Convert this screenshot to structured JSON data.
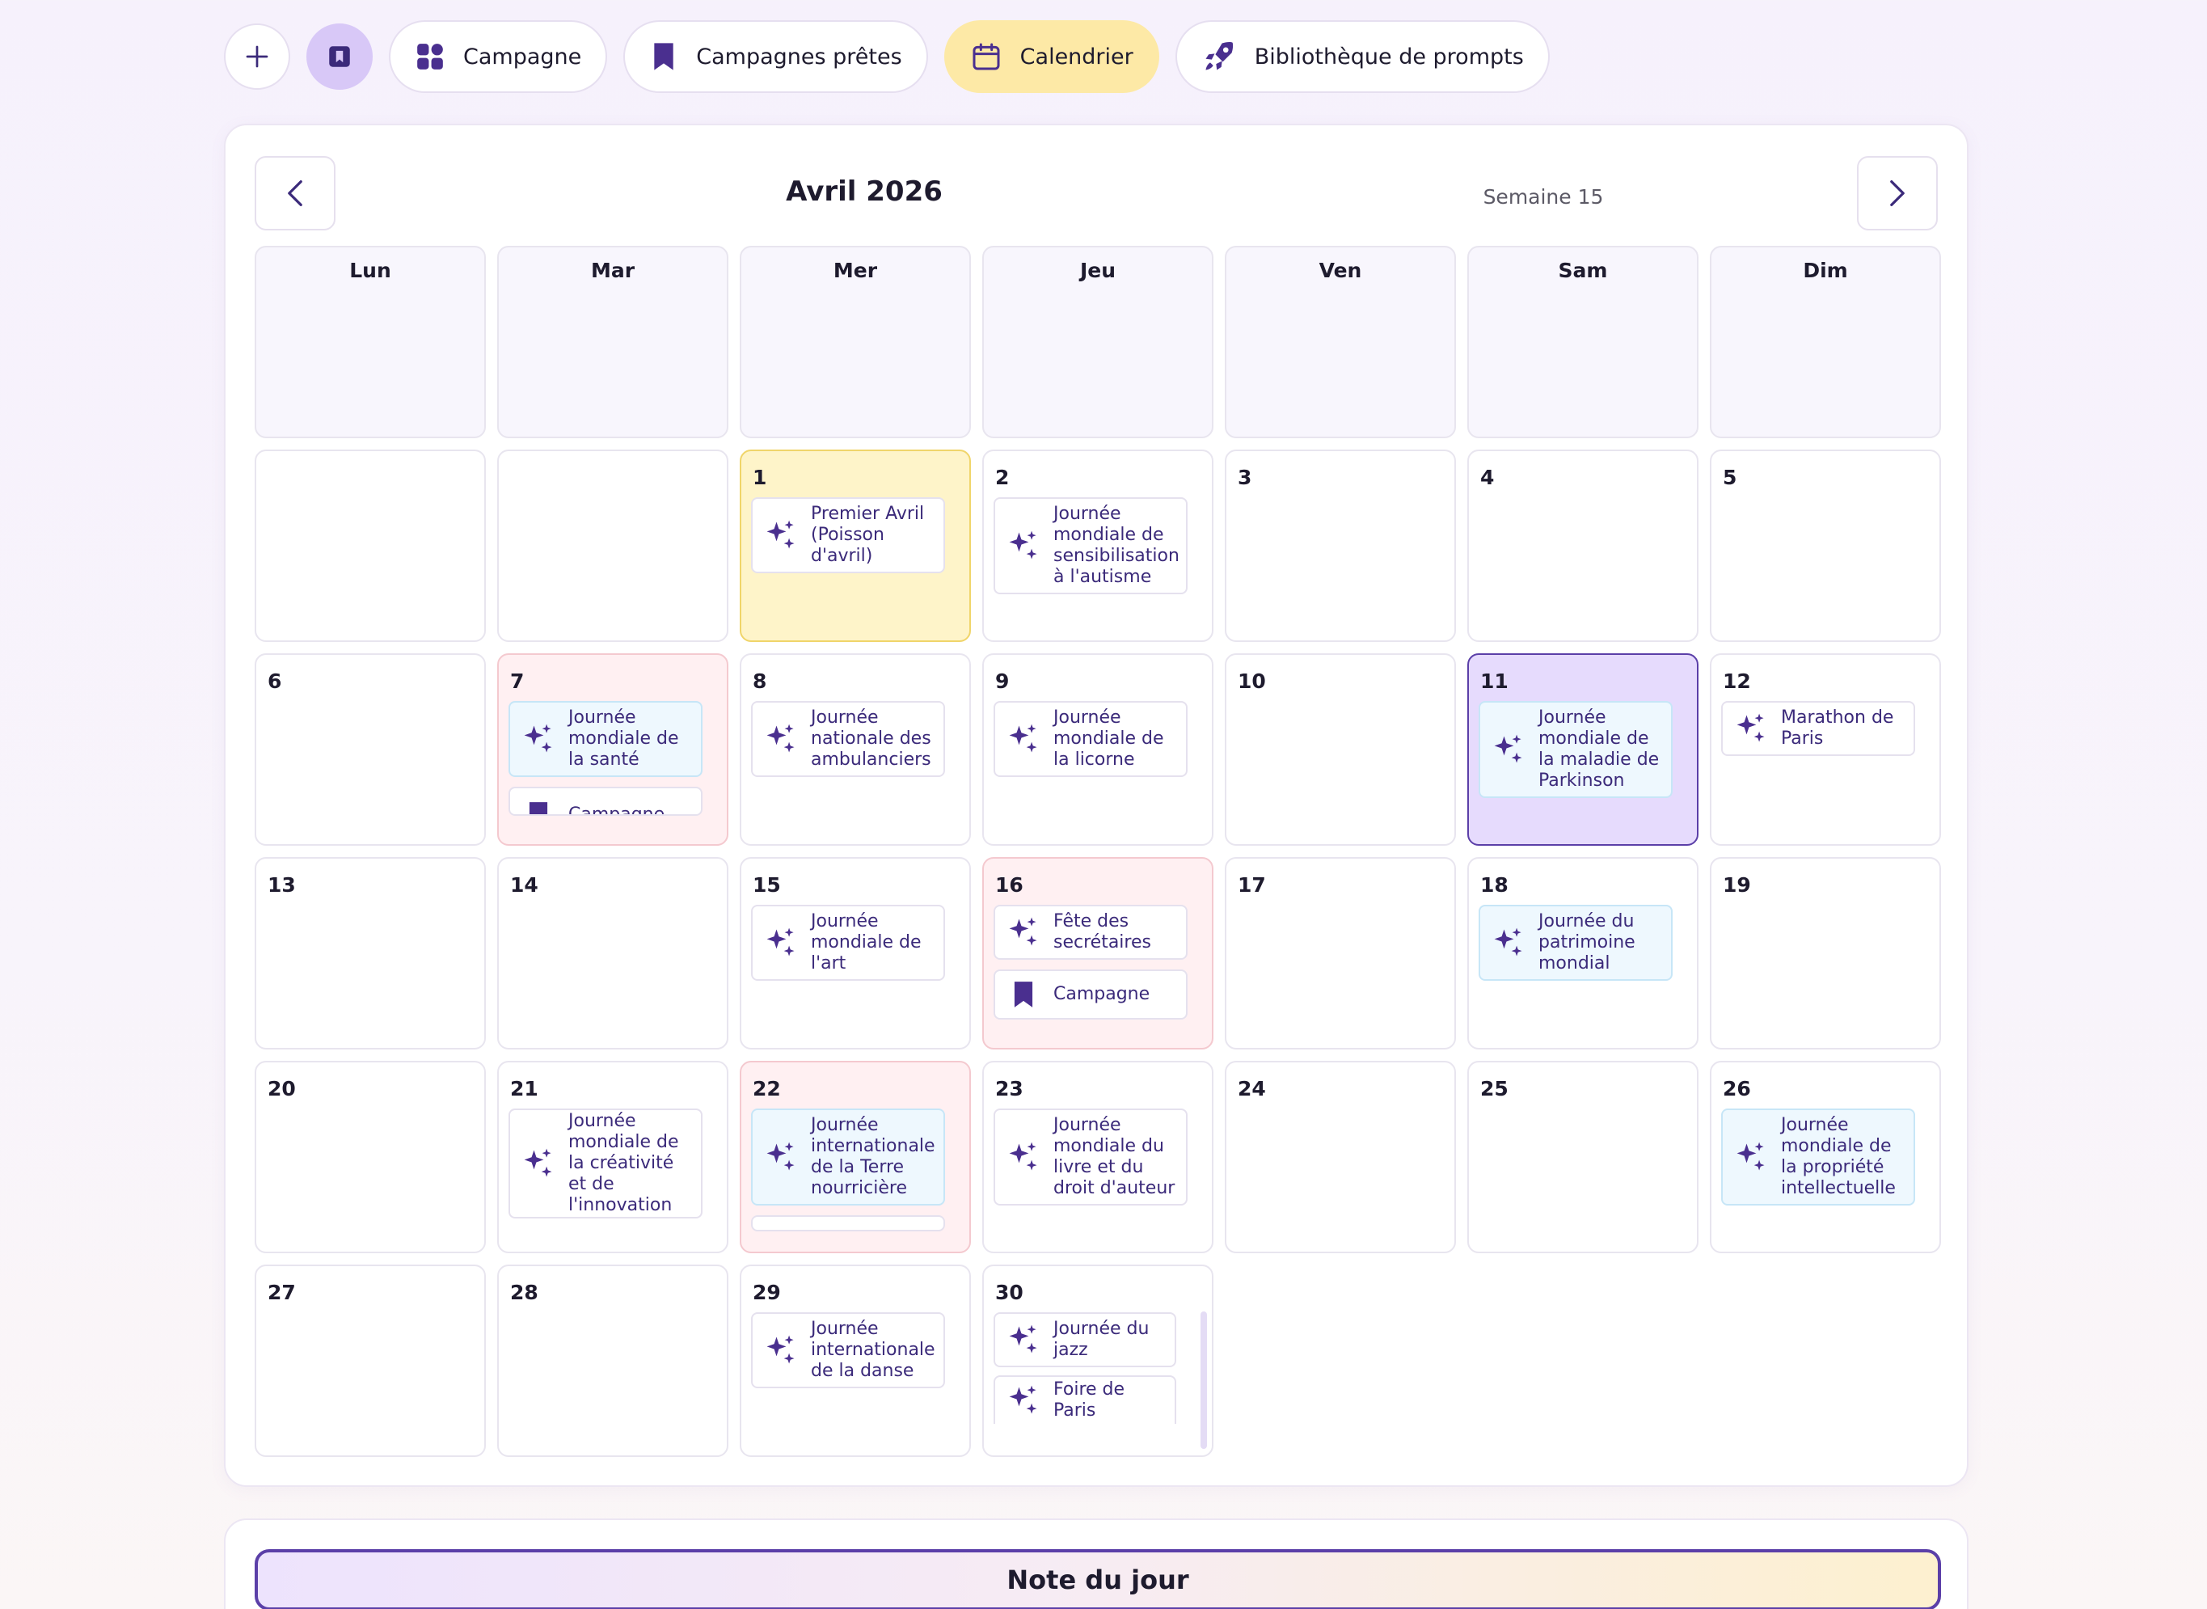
{
  "toolbar": {
    "campaign_label": "Campagne",
    "ready_campaigns_label": "Campagnes prêtes",
    "calendar_label": "Calendrier",
    "prompt_library_label": "Bibliothèque de prompts"
  },
  "calendar": {
    "month_title": "Avril 2026",
    "week_label": "Semaine 15",
    "weekdays": [
      "Lun",
      "Mar",
      "Mer",
      "Jeu",
      "Ven",
      "Sam",
      "Dim"
    ],
    "days": {
      "d1": {
        "num": "1",
        "events": [
          "Premier Avril (Poisson d'avril)"
        ]
      },
      "d2": {
        "num": "2",
        "events": [
          "Journée mondiale de sensibilisation à l'autisme"
        ]
      },
      "d3": {
        "num": "3"
      },
      "d4": {
        "num": "4"
      },
      "d5": {
        "num": "5"
      },
      "d6": {
        "num": "6"
      },
      "d7": {
        "num": "7",
        "events": [
          "Journée mondiale de la santé",
          "Campagne"
        ]
      },
      "d8": {
        "num": "8",
        "events": [
          "Journée nationale des ambulanciers"
        ]
      },
      "d9": {
        "num": "9",
        "events": [
          "Journée mondiale de la licorne"
        ]
      },
      "d10": {
        "num": "10"
      },
      "d11": {
        "num": "11",
        "events": [
          "Journée mondiale de la maladie de Parkinson"
        ]
      },
      "d12": {
        "num": "12",
        "events": [
          "Marathon de Paris"
        ]
      },
      "d13": {
        "num": "13"
      },
      "d14": {
        "num": "14"
      },
      "d15": {
        "num": "15",
        "events": [
          "Journée mondiale de l'art"
        ]
      },
      "d16": {
        "num": "16",
        "events": [
          "Fête des secrétaires",
          "Campagne"
        ]
      },
      "d17": {
        "num": "17"
      },
      "d18": {
        "num": "18",
        "events": [
          "Journée du patrimoine mondial"
        ]
      },
      "d19": {
        "num": "19"
      },
      "d20": {
        "num": "20"
      },
      "d21": {
        "num": "21",
        "events": [
          "Journée mondiale de la créativité et de l'innovation"
        ]
      },
      "d22": {
        "num": "22",
        "events": [
          "Journée internationale de la Terre nourricière"
        ]
      },
      "d23": {
        "num": "23",
        "events": [
          "Journée mondiale du livre et du droit d'auteur"
        ]
      },
      "d24": {
        "num": "24"
      },
      "d25": {
        "num": "25"
      },
      "d26": {
        "num": "26",
        "events": [
          "Journée mondiale de la propriété intellectuelle"
        ]
      },
      "d27": {
        "num": "27"
      },
      "d28": {
        "num": "28"
      },
      "d29": {
        "num": "29",
        "events": [
          "Journée internationale de la danse"
        ]
      },
      "d30": {
        "num": "30",
        "events": [
          "Journée du jazz",
          "Foire de Paris"
        ]
      }
    }
  },
  "note": {
    "title": "Note du jour"
  },
  "colors": {
    "accent": "#5b3fa8",
    "event_text": "#3b2a7a",
    "today_bg": "#fef4c9",
    "selected_bg": "#e6dbfd",
    "campaign_day_bg": "#fff0f2",
    "calendar_pill_bg": "#fde9a6"
  }
}
